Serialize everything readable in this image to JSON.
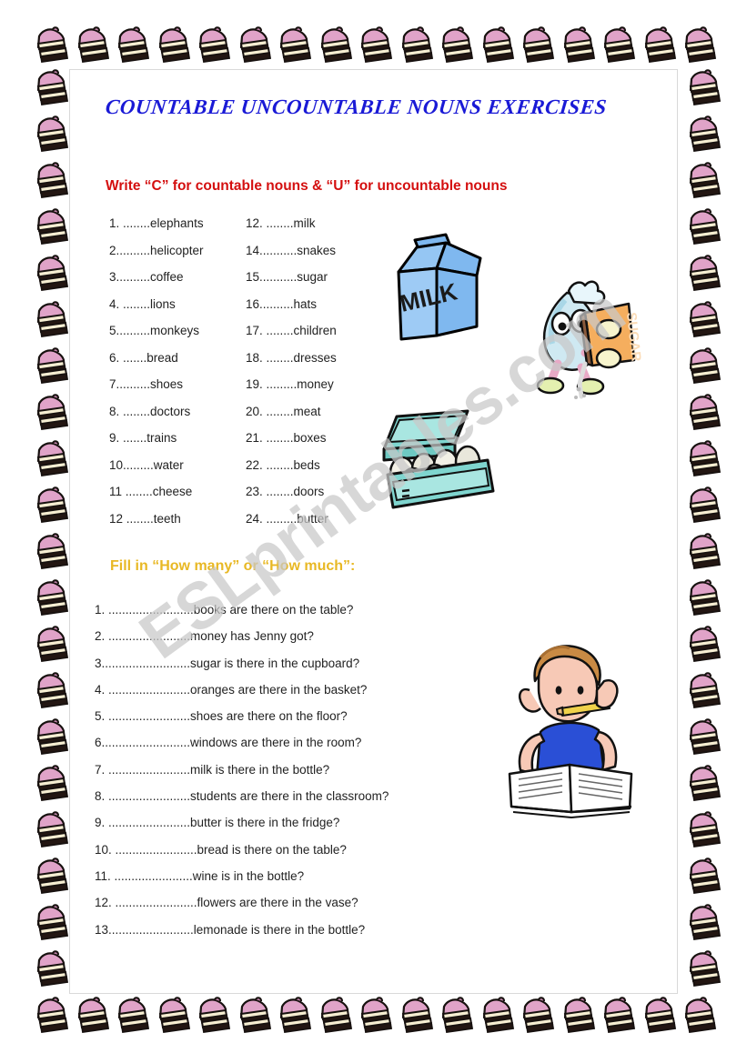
{
  "title": "COUNTABLE UNCOUNTABLE NOUNS EXERCISES",
  "section1": {
    "instruction": "Write “C” for countable nouns & “U” for uncountable nouns",
    "column1": [
      "1. ........elephants",
      "2..........helicopter",
      "3..........coffee",
      "4. ........lions",
      "5..........monkeys",
      "6. .......bread",
      "7..........shoes",
      "8. ........doctors",
      "9. .......trains",
      "10.........water",
      "11 ........cheese",
      "12 ........teeth"
    ],
    "column2": [
      "12. ........milk",
      "14...........snakes",
      "15...........sugar",
      "16..........hats",
      "17. ........children",
      "18. ........dresses",
      "19. .........money",
      "20. ........meat",
      "21. ........boxes",
      "22. ........beds",
      "23. ........doors",
      "24. .........butter"
    ]
  },
  "section2": {
    "heading": "Fill in “How many” or “How much”:",
    "questions": [
      "1. .........................books are there on the table?",
      "2. ........................money has Jenny got?",
      "3..........................sugar is there in the cupboard?",
      "4. ........................oranges are there in the basket?",
      "5. ........................shoes are there on the floor?",
      "6..........................windows are there in the room?",
      "7. ........................milk is there in the bottle?",
      "8. ........................students are there in the classroom?",
      "9. ........................butter is there in the fridge?",
      "10. ........................bread is there on the table?",
      "11. .......................wine is in the bottle?",
      "12. ........................flowers are there in the vase?",
      "13.........................lemonade is there in the bottle?"
    ]
  },
  "watermark": "ESLprintables.com",
  "clipart": {
    "milk_label": "MILK",
    "sugar_label": "SUGAR",
    "milk_name": "milk-carton-illustration",
    "sugar_name": "sugar-character-illustration",
    "eggs_name": "egg-carton-illustration",
    "boy_name": "boy-reading-illustration"
  },
  "colors": {
    "title": "#1a1ad6",
    "instruction_red": "#d40f0f",
    "heading_gold": "#e8b824",
    "milk_blue": "#7fb8ef",
    "egg_teal": "#7fd5cf",
    "sugar_orange": "#f5ae5e",
    "shirt_blue": "#2a4fd6",
    "cake_pink": "#e8a6c8",
    "watermark_gray": "#c9c9c9"
  },
  "border": {
    "icon": "cake-slice-icon",
    "top_count": 17,
    "bottom_count": 17,
    "side_count": 20
  }
}
